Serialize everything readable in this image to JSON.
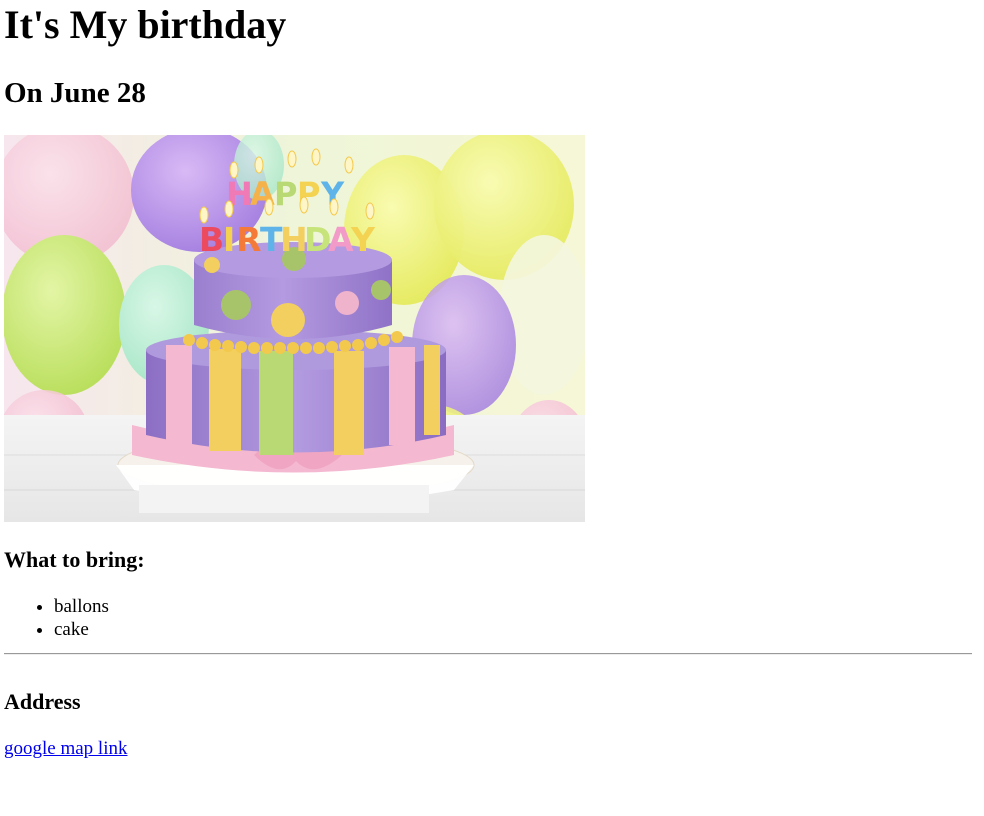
{
  "page": {
    "title": "It's My birthday",
    "subtitle": "On June 28"
  },
  "hero_image": {
    "alt": "birthday cake photo",
    "candles_top": "HAPPY",
    "candles_bottom": "BIRTHDAY"
  },
  "bring": {
    "heading": "What to bring:",
    "items": [
      "ballons",
      "cake"
    ]
  },
  "address": {
    "heading": "Address",
    "link_text": "google map link"
  },
  "colors": {
    "link": "#0000ee",
    "cake_purple": "#a58bd6",
    "ribbon_pink": "#f4b8d0",
    "stripe_yellow": "#f2cf5e",
    "stripe_green": "#b9d975"
  }
}
